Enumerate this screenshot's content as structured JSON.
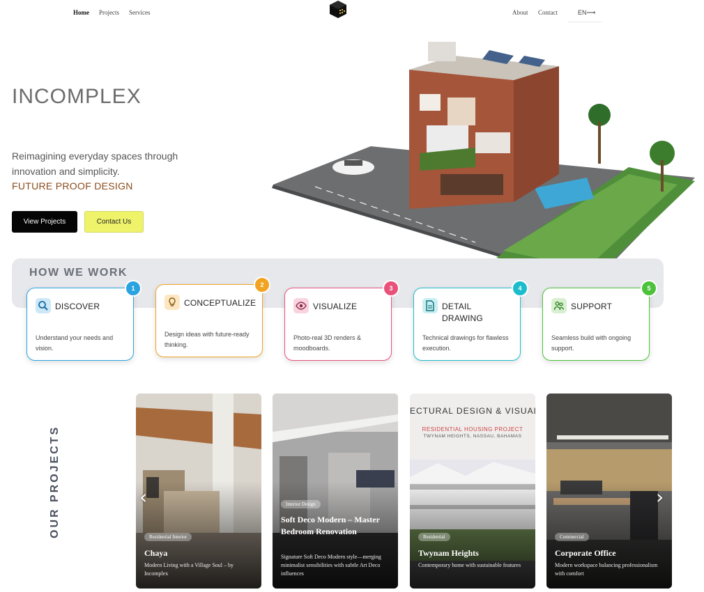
{
  "nav": {
    "home": "Home",
    "projects": "Projects",
    "services": "Services",
    "about": "About",
    "contact": "Contact",
    "lang": "EN⟶"
  },
  "hero": {
    "brand": "INCOMPLEX",
    "tagline": "Reimagining everyday spaces through innovation and simplicity.",
    "subtagline": "FUTURE PROOF DESIGN",
    "primary_button": "View Projects",
    "secondary_button": "Contact Us"
  },
  "how": {
    "title": "HOW WE WORK",
    "steps": [
      {
        "num": "1",
        "title": "DISCOVER",
        "desc": "Understand your needs and vision.",
        "color": "#2aa3e0",
        "icon": "search-icon"
      },
      {
        "num": "2",
        "title": "CONCEPTUALIZE",
        "desc": "Design ideas with future-ready thinking.",
        "color": "#f1a321",
        "icon": "lightbulb-icon"
      },
      {
        "num": "3",
        "title": "VISUALIZE",
        "desc": "Photo-real 3D renders & moodboards.",
        "color": "#e8527a",
        "icon": "eye-icon"
      },
      {
        "num": "4",
        "title": "DETAIL\nDRAWING",
        "desc": "Technical drawings for flawless execution.",
        "color": "#1bbccb",
        "icon": "document-icon"
      },
      {
        "num": "5",
        "title": "SUPPORT",
        "desc": "Seamless build with ongoing support.",
        "color": "#4cc23a",
        "icon": "people-icon"
      }
    ]
  },
  "projects": {
    "section_title": "OUR PROJECTS",
    "items": [
      {
        "tag": "Residential Interior",
        "title": "Chaya",
        "desc": "Modern Living with a Village Soul – by Incomplex"
      },
      {
        "tag": "Interior Design",
        "title": "Soft Deco Modern – Master Bedroom Renovation",
        "desc": "Signature Soft Deco Modern style—merging minimalist sensibilities with subtle Art Deco influences"
      },
      {
        "tag": "Residential",
        "title": "Twynam Heights",
        "desc": "Contemporary home with sustainable features",
        "image_caption_1": "ECTURAL DESIGN & VISUAL",
        "image_caption_2": "RESIDENTIAL HOUSING PROJECT",
        "image_caption_3": "TWYNAM HEIGHTS, NASSAU, BAHAMAS"
      },
      {
        "tag": "Commercial",
        "title": "Corporate Office",
        "desc": "Modern workspace balancing professionalism with comfort"
      }
    ],
    "prev": "‹",
    "next": "›"
  }
}
